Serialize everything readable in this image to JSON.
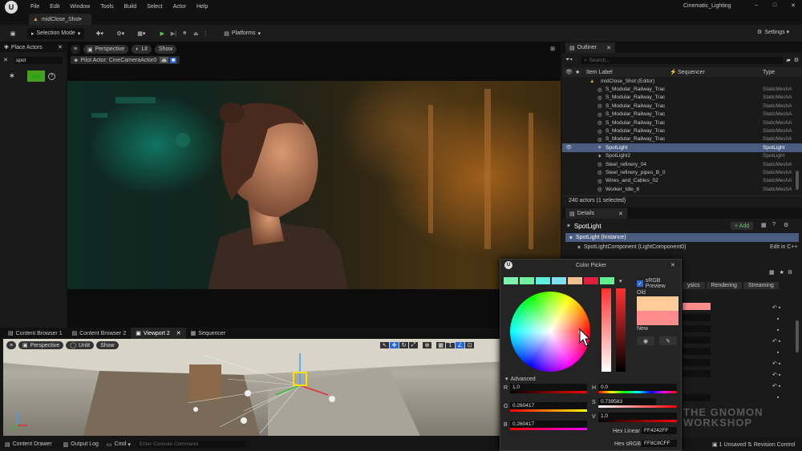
{
  "app": {
    "menu": [
      "File",
      "Edit",
      "Window",
      "Tools",
      "Build",
      "Select",
      "Actor",
      "Help"
    ],
    "project": "Cinematic_Lighting",
    "tab": "midClose_Shot•"
  },
  "toolbar": {
    "mode": "Selection Mode",
    "platforms": "Platforms",
    "settings": "Settings"
  },
  "place_actors": {
    "title": "Place Actors",
    "search": "spot"
  },
  "viewport": {
    "perspective": "Perspective",
    "lit": "Lit",
    "show": "Show",
    "pilot": "Pilot Actor: CineCameraActor0"
  },
  "bottom_tabs": [
    "Content Browser 1",
    "Content Browser 2",
    "Viewport 2",
    "Sequencer"
  ],
  "viewport2": {
    "perspective": "Perspective",
    "unlit": "Unlit",
    "show": "Show",
    "snap": "1"
  },
  "statusbar": {
    "content_drawer": "Content Drawer",
    "output_log": "Output Log",
    "cmd": "Cmd",
    "console_placeholder": "Enter Console Command",
    "unsaved": "1 Unsaved",
    "revision": "Revision Control"
  },
  "outliner": {
    "title": "Outliner",
    "search_placeholder": "Search...",
    "col_label": "Item Label",
    "col_sequencer": "Sequencer",
    "col_type": "Type",
    "folder": "midClose_Shot (Editor)",
    "rows": [
      {
        "name": "S_Modular_Railway_Trac",
        "type": "StaticMeshA"
      },
      {
        "name": "S_Modular_Railway_Trac",
        "type": "StaticMeshA"
      },
      {
        "name": "S_Modular_Railway_Trac",
        "type": "StaticMeshA"
      },
      {
        "name": "S_Modular_Railway_Trac",
        "type": "StaticMeshA"
      },
      {
        "name": "S_Modular_Railway_Trac",
        "type": "StaticMeshA"
      },
      {
        "name": "S_Modular_Railway_Trac",
        "type": "StaticMeshA"
      },
      {
        "name": "S_Modular_Railway_Trac",
        "type": "StaticMeshA"
      },
      {
        "name": "SpotLight",
        "type": "SpotLight"
      },
      {
        "name": "SpotLight2",
        "type": "SpotLight"
      },
      {
        "name": "Steel_refinery_04",
        "type": "StaticMeshA"
      },
      {
        "name": "Steel_refinery_pipes_B_0",
        "type": "StaticMeshA"
      },
      {
        "name": "Wires_and_Cables_02",
        "type": "StaticMeshA"
      },
      {
        "name": "Worker_Idle_6",
        "type": "StaticMeshA"
      }
    ],
    "footer": "240 actors (1 selected)"
  },
  "details": {
    "title": "Details",
    "actor": "SpotLight",
    "add": "+ Add",
    "instance": "SpotLight (Instance)",
    "component": "SpotLightComponent (LightComponent0)",
    "edit_cpp": "Edit in C++",
    "tabs": [
      "ysics",
      "Rendering",
      "Streaming"
    ]
  },
  "color_picker": {
    "title": "Color Picker",
    "srgb_preview": "sRGB Preview",
    "old": "Old",
    "new": "New",
    "advanced": "Advanced",
    "r": "1.0",
    "g": "0.260417",
    "b": "0.260417",
    "h": "0.0",
    "s": "0.739583",
    "v": "1.0",
    "hex_linear_label": "Hex Linear",
    "hex_linear": "FF4242FF",
    "hex_srgb_label": "Hex sRGB",
    "hex_srgb": "FF8C8CFF",
    "old_color": "#FFCC99",
    "new_color": "#FF8C8C",
    "swatches": [
      "#7ef0b0",
      "#70f0a0",
      "#60f0e0",
      "#80e0f0",
      "#f0c090",
      "#e02040",
      "#60f090"
    ]
  },
  "watermark": {
    "line1": "THE GNOMON",
    "line2": "WORKSHOP"
  }
}
